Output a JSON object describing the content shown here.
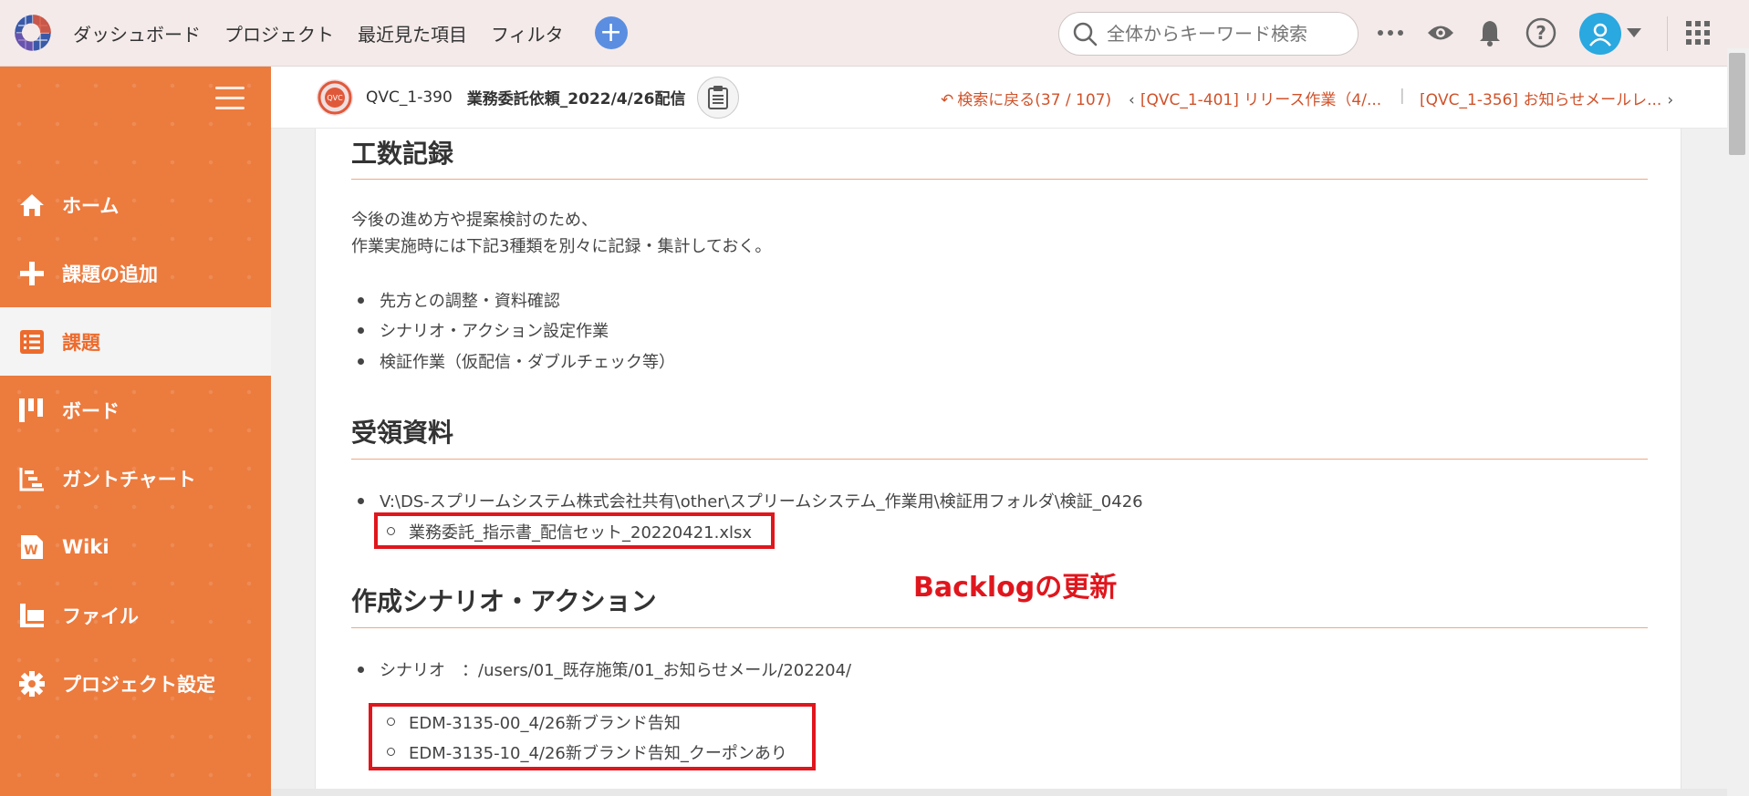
{
  "topbar": {
    "nav": [
      "ダッシュボード",
      "プロジェクト",
      "最近見た項目",
      "フィルタ"
    ],
    "search_placeholder": "全体からキーワード検索",
    "icons": [
      "more-icon",
      "eye-icon",
      "bell-icon",
      "help-icon",
      "user-avatar-icon",
      "apps-grid-icon"
    ],
    "accent": "#5b8ee0"
  },
  "sidebar": {
    "color": "#ec7b3e",
    "items": [
      {
        "label": "ホーム",
        "icon": "home-icon"
      },
      {
        "label": "課題の追加",
        "icon": "plus-icon"
      },
      {
        "label": "課題",
        "icon": "list-icon",
        "active": true
      },
      {
        "label": "ボード",
        "icon": "board-icon"
      },
      {
        "label": "ガントチャート",
        "icon": "gantt-icon"
      },
      {
        "label": "Wiki",
        "icon": "wiki-icon"
      },
      {
        "label": "ファイル",
        "icon": "folder-icon"
      },
      {
        "label": "プロジェクト設定",
        "icon": "gear-icon"
      }
    ]
  },
  "issue": {
    "key": "QVC_1-390",
    "title": "業務委託依頼_2022/4/26配信",
    "back_label": "検索に戻る(37 / 107)",
    "prev_label": "[QVC_1-401] リリース作業（4/...",
    "next_label": "[QVC_1-356] お知らせメールレ..."
  },
  "content": {
    "section1": {
      "heading": "工数記録",
      "para1": "今後の進め方や提案検討のため、",
      "para2": "作業実施時には下記3種類を別々に記録・集計しておく。",
      "bullets": [
        "先方との調整・資料確認",
        "シナリオ・アクション設定作業",
        "検証作業（仮配信・ダブルチェック等）"
      ]
    },
    "section2": {
      "heading": "受領資料",
      "bullet": "V:\\DS-スプリームシステム株式会社共有\\other\\スプリームシステム_作業用\\検証用フォルダ\\検証_0426",
      "sub": "業務委託_指示書_配信セット_20220421.xlsx"
    },
    "section3": {
      "heading": "作成シナリオ・アクション",
      "bullet": "シナリオ　：/users/01_既存施策/01_お知らせメール/202204/",
      "subs": [
        "EDM-3135-00_4/26新ブランド告知",
        "EDM-3135-10_4/26新ブランド告知_クーポンあり"
      ]
    },
    "annotation": "Backlogの更新"
  }
}
